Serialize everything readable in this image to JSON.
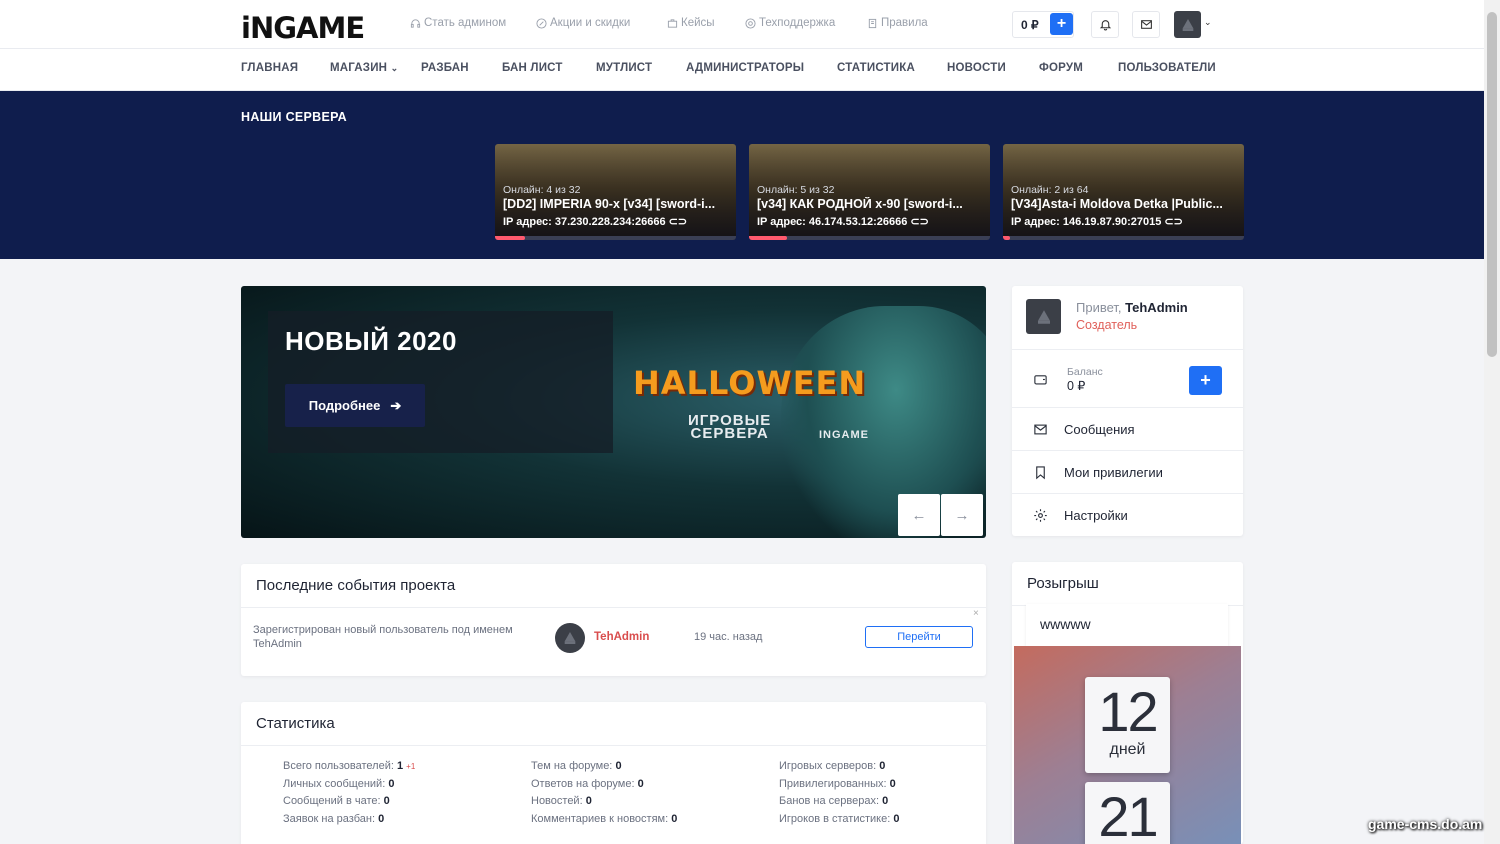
{
  "header": {
    "logo": "iNGAME",
    "links": [
      {
        "label": "Стать админом",
        "icon": "headset-icon"
      },
      {
        "label": "Акции и скидки",
        "icon": "percent-icon"
      },
      {
        "label": "Кейсы",
        "icon": "case-icon"
      },
      {
        "label": "Техподдержка",
        "icon": "support-icon"
      },
      {
        "label": "Правила",
        "icon": "document-icon"
      }
    ],
    "balance": "0 ₽",
    "add": "+"
  },
  "nav": {
    "items": [
      "ГЛАВНАЯ",
      "МАГАЗИН",
      "РАЗБАН",
      "БАН ЛИСТ",
      "МУТЛИСТ",
      "АДМИНИСТРАТОРЫ",
      "СТАТИСТИКА",
      "НОВОСТИ",
      "ФОРУМ",
      "ПОЛЬЗОВАТЕЛИ"
    ]
  },
  "servers": {
    "title": "НАШИ СЕРВЕРА",
    "list": [
      {
        "online": "Онлайн: 4 из 32",
        "name": "[DD2] IMPERIA 90-x [v34] [sword-i...",
        "ip": "IP адрес: 37.230.228.234:26666",
        "load": 0.125
      },
      {
        "online": "Онлайн: 5 из 32",
        "name": "[v34] КАК РОДНОЙ x-90 [sword-i...",
        "ip": "IP адрес: 46.174.53.12:26666",
        "load": 0.156
      },
      {
        "online": "Онлайн: 2 из 64",
        "name": "[V34]Asta-i Moldova Detka |Public...",
        "ip": "IP адрес: 146.19.87.90:27015",
        "load": 0.031
      }
    ],
    "accent": "#ff5a6e"
  },
  "slider": {
    "title": "НОВЫЙ 2020",
    "button": "Подробнее",
    "banner": "HALLOWEEN",
    "banner_sub": "ИГРОВЫЕ\nСЕРВЕРА",
    "banner_brand": "INGAME",
    "prev": "←",
    "next": "→"
  },
  "events": {
    "title": "Последние события проекта",
    "close": "×",
    "text": "Зарегистрирован новый пользователь под именем TehAdmin",
    "user": "TehAdmin",
    "time": "19 час. назад",
    "button": "Перейти"
  },
  "stats": {
    "title": "Статистика",
    "col1": [
      {
        "label": "Всего пользователей:",
        "value": "1",
        "extra": "+1"
      },
      {
        "label": "Личных сообщений:",
        "value": "0"
      },
      {
        "label": "Сообщений в чате:",
        "value": "0"
      },
      {
        "label": "Заявок на разбан:",
        "value": "0"
      }
    ],
    "col2": [
      {
        "label": "Тем на форуме:",
        "value": "0"
      },
      {
        "label": "Ответов на форуме:",
        "value": "0"
      },
      {
        "label": "Новостей:",
        "value": "0"
      },
      {
        "label": "Комментариев к новостям:",
        "value": "0"
      }
    ],
    "col3": [
      {
        "label": "Игровых серверов:",
        "value": "0"
      },
      {
        "label": "Привилегированных:",
        "value": "0"
      },
      {
        "label": "Банов на серверах:",
        "value": "0"
      },
      {
        "label": "Игроков в статистике:",
        "value": "0"
      }
    ]
  },
  "profile": {
    "greeting": "Привет,",
    "name": "TehAdmin",
    "role": "Создатель",
    "balance_label": "Баланс",
    "balance_value": "0 ₽",
    "add": "+",
    "menu": [
      {
        "label": "Сообщения",
        "icon": "envelope-icon"
      },
      {
        "label": "Мои привилегии",
        "icon": "bookmark-icon"
      },
      {
        "label": "Настройки",
        "icon": "gear-icon"
      }
    ]
  },
  "giveaway": {
    "title": "Розыгрыш",
    "name": "wwwww",
    "days_value": "12",
    "days_label": "дней",
    "hours_value": "21"
  },
  "watermark": "game-cms.do.am"
}
